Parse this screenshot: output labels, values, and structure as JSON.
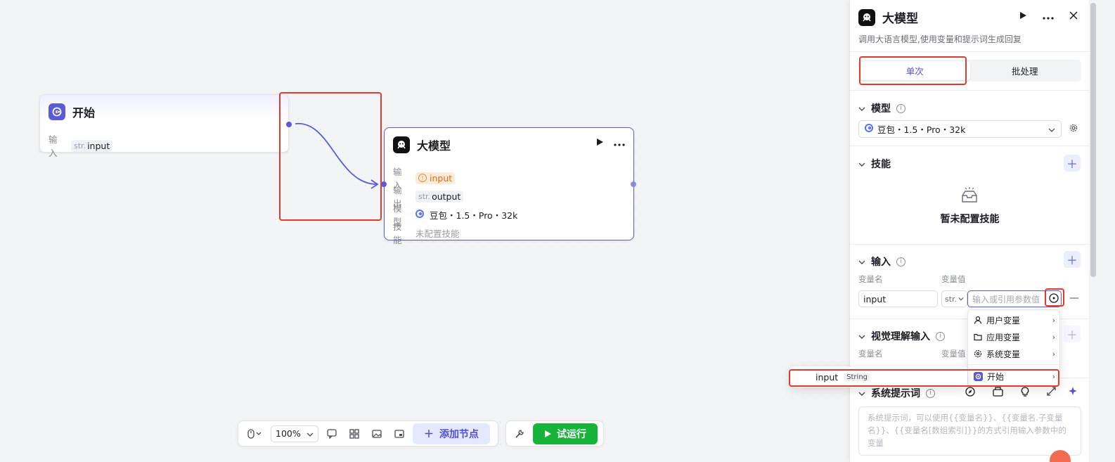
{
  "canvas": {
    "start_node": {
      "title": "开始",
      "input_label": "输入",
      "input_type": "str.",
      "input_name": "input"
    },
    "llm_node": {
      "title": "大模型",
      "input_label": "输入",
      "input_value": "input",
      "output_label": "输出",
      "output_type": "str.",
      "output_value": "output",
      "model_label": "模型",
      "model_value": "豆包・1.5・Pro・32k",
      "skill_label": "技能",
      "skill_value": "未配置技能"
    }
  },
  "toolbar": {
    "zoom": "100%",
    "add_node": "添加节点",
    "run": "试运行"
  },
  "panel": {
    "title": "大模型",
    "description": "调用大语言模型,使用变量和提示词生成回复",
    "tabs": [
      {
        "label": "单次",
        "active": true
      },
      {
        "label": "批处理",
        "active": false
      }
    ],
    "model": {
      "title": "模型",
      "value": "豆包・1.5・Pro・32k"
    },
    "skills": {
      "title": "技能",
      "empty": "暂未配置技能"
    },
    "input": {
      "title": "输入",
      "col_name": "变量名",
      "col_value": "变量值",
      "var_name": "input",
      "var_type": "str.",
      "value_placeholder": "输入或引用参数值"
    },
    "vision": {
      "title": "视觉理解输入",
      "col_name": "变量名",
      "col_value": "变量值"
    },
    "system_prompt": {
      "title": "系统提示词",
      "placeholder": "系统提示词，可以使用{{变量名}}、{{变量名.子变量名}}、{{变量名[数组索引]}}的方式引用输入参数中的变量"
    }
  },
  "menu": {
    "items": [
      {
        "label": "用户变量",
        "icon": "user-icon"
      },
      {
        "label": "应用变量",
        "icon": "folder-icon"
      },
      {
        "label": "系统变量",
        "icon": "gear-icon"
      },
      {
        "label": "开始",
        "icon": "start-node-icon"
      }
    ],
    "submenu": {
      "name": "input",
      "type": "String"
    }
  },
  "colors": {
    "accent": "#5b5bd6",
    "run_green": "#18b33b",
    "highlight_red": "#e23b2e"
  }
}
